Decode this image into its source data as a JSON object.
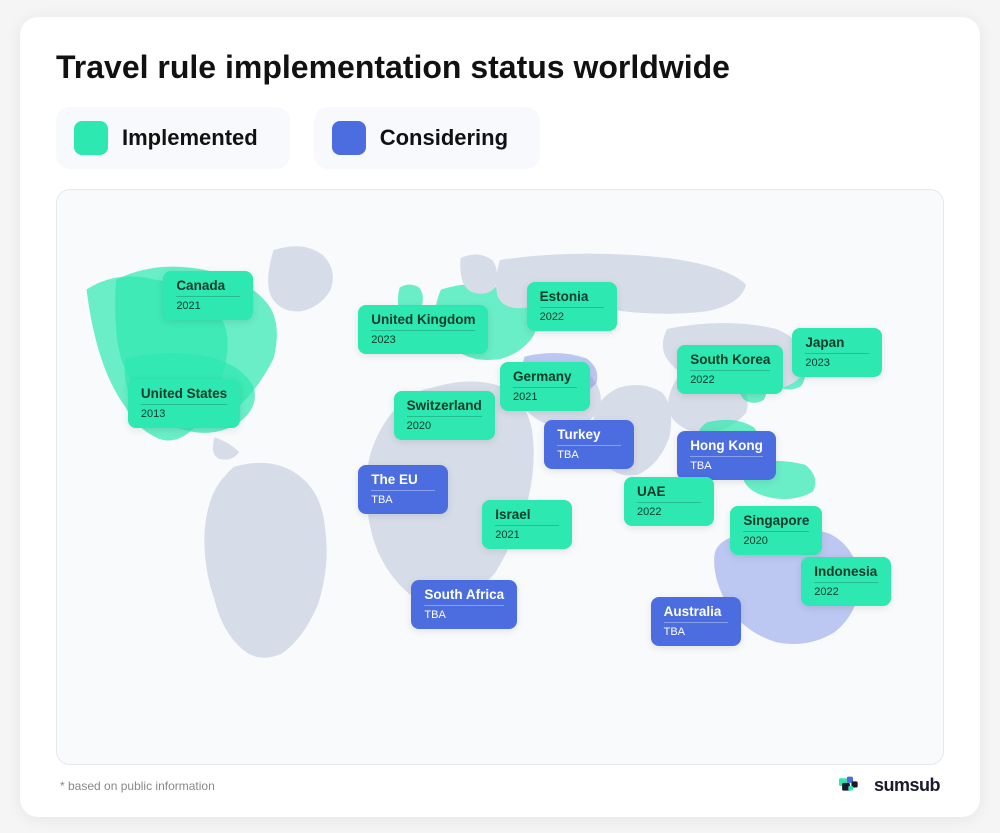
{
  "title": "Travel rule implementation status worldwide",
  "legend": {
    "implemented": {
      "label": "Implemented",
      "color": "#2de8b0",
      "type": "green"
    },
    "considering": {
      "label": "Considering",
      "color": "#4b6de0",
      "type": "blue"
    }
  },
  "countries": [
    {
      "id": "canada",
      "name": "Canada",
      "year": "2021",
      "type": "green",
      "left": "12%",
      "top": "14%"
    },
    {
      "id": "united-states",
      "name": "United States",
      "year": "2013",
      "type": "green",
      "left": "8%",
      "top": "33%"
    },
    {
      "id": "united-kingdom",
      "name": "United Kingdom",
      "year": "2023",
      "type": "green",
      "left": "34%",
      "top": "20%"
    },
    {
      "id": "switzerland",
      "name": "Switzerland",
      "year": "2020",
      "type": "green",
      "left": "38%",
      "top": "35%"
    },
    {
      "id": "the-eu",
      "name": "The EU",
      "year": "TBA",
      "type": "blue",
      "left": "34%",
      "top": "48%"
    },
    {
      "id": "israel",
      "name": "Israel",
      "year": "2021",
      "type": "green",
      "left": "48%",
      "top": "54%"
    },
    {
      "id": "south-africa",
      "name": "South Africa",
      "year": "TBA",
      "type": "blue",
      "left": "40%",
      "top": "68%"
    },
    {
      "id": "estonia",
      "name": "Estonia",
      "year": "2022",
      "type": "green",
      "left": "53%",
      "top": "16%"
    },
    {
      "id": "germany",
      "name": "Germany",
      "year": "2021",
      "type": "green",
      "left": "50%",
      "top": "30%"
    },
    {
      "id": "turkey",
      "name": "Turkey",
      "year": "TBA",
      "type": "blue",
      "left": "55%",
      "top": "40%"
    },
    {
      "id": "south-korea",
      "name": "South Korea",
      "year": "2022",
      "type": "green",
      "left": "70%",
      "top": "27%"
    },
    {
      "id": "japan",
      "name": "Japan",
      "year": "2023",
      "type": "green",
      "left": "83%",
      "top": "24%"
    },
    {
      "id": "hong-kong",
      "name": "Hong Kong",
      "year": "TBA",
      "type": "blue",
      "left": "70%",
      "top": "42%"
    },
    {
      "id": "uae",
      "name": "UAE",
      "year": "2022",
      "type": "green",
      "left": "64%",
      "top": "50%"
    },
    {
      "id": "singapore",
      "name": "Singapore",
      "year": "2020",
      "type": "green",
      "left": "76%",
      "top": "55%"
    },
    {
      "id": "indonesia",
      "name": "Indonesia",
      "year": "2022",
      "type": "green",
      "left": "84%",
      "top": "64%"
    },
    {
      "id": "australia",
      "name": "Australia",
      "year": "TBA",
      "type": "blue",
      "left": "67%",
      "top": "71%"
    }
  ],
  "footer": {
    "note": "* based on public information",
    "brand": "sumsub"
  }
}
